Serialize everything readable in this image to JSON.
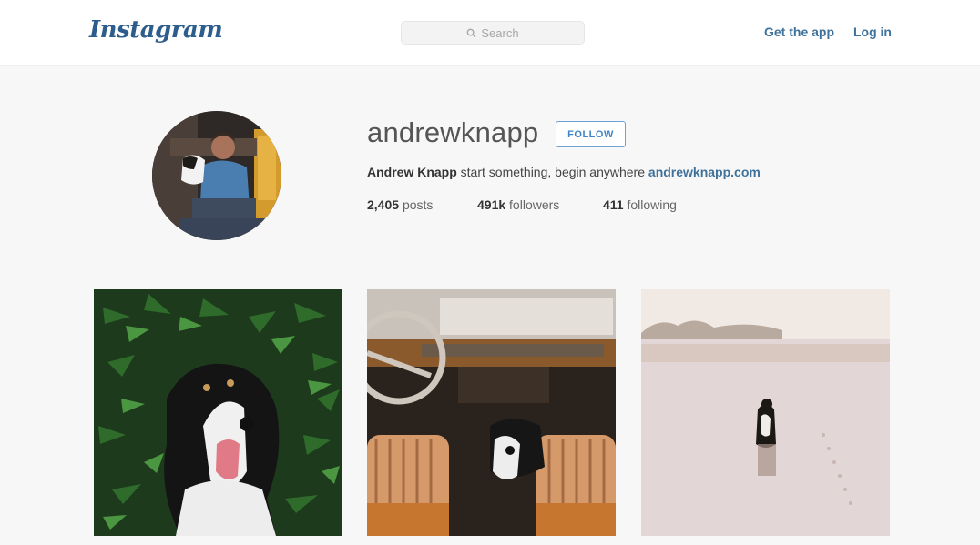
{
  "header": {
    "logo": "Instagram",
    "search_placeholder": "Search",
    "get_app_label": "Get the app",
    "login_label": "Log in"
  },
  "profile": {
    "username": "andrewknapp",
    "follow_label": "FOLLOW",
    "full_name": "Andrew Knapp",
    "bio_text": "start something, begin anywhere",
    "website": "andrewknapp.com",
    "stats": {
      "posts_count": "2,405",
      "posts_label": "posts",
      "followers_count": "491k",
      "followers_label": "followers",
      "following_count": "411",
      "following_label": "following"
    }
  },
  "icons": {
    "search": "search-icon"
  },
  "colors": {
    "link_blue": "#3f729b",
    "follow_blue": "#3f86c7",
    "background": "#f7f7f7"
  }
}
